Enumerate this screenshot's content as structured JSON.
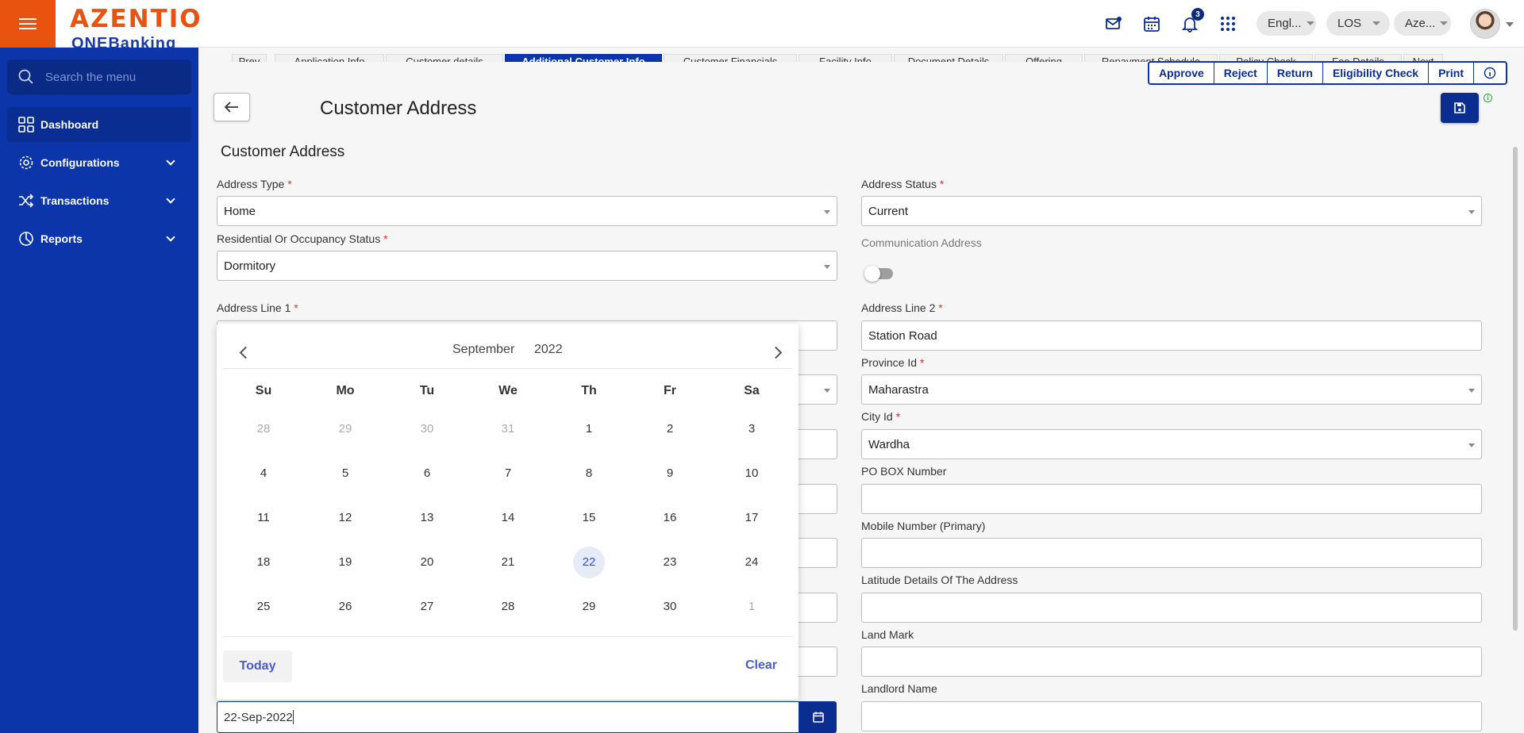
{
  "header": {
    "logo_main": "AZENTIO",
    "logo_sub": "ONEBanking",
    "notification_count": "3",
    "language": "Engl...",
    "module": "LOS",
    "entity": "Aze..."
  },
  "sidebar": {
    "search_placeholder": "Search the menu",
    "items": [
      {
        "label": "Dashboard",
        "icon": "dashboard-icon"
      },
      {
        "label": "Configurations",
        "icon": "gear-icon"
      },
      {
        "label": "Transactions",
        "icon": "shuffle-icon"
      },
      {
        "label": "Reports",
        "icon": "pie-chart-icon"
      }
    ]
  },
  "tabs": [
    "Prev",
    "Application Info",
    "Customer details",
    "Additional Customer Info",
    "Customer Financials",
    "Facility Info",
    "Document Details",
    "Offering",
    "Repayment Schedule",
    "Policy Check",
    "Fee Details",
    "Next"
  ],
  "active_tab": "Additional Customer Info",
  "actions": [
    "Approve",
    "Reject",
    "Return",
    "Eligibility Check",
    "Print"
  ],
  "page": {
    "title": "Customer Address",
    "section_title": "Customer Address"
  },
  "form": {
    "address_type": {
      "label": "Address Type",
      "value": "Home"
    },
    "address_status": {
      "label": "Address Status",
      "value": "Current"
    },
    "residential_status": {
      "label": "Residential Or Occupancy Status",
      "value": "Dormitory"
    },
    "communication_address": {
      "label": "Communication Address"
    },
    "address_line_1": {
      "label": "Address Line 1",
      "value": ""
    },
    "address_line_2": {
      "label": "Address Line 2",
      "value": "Station Road"
    },
    "province_id": {
      "label": "Province Id",
      "value": "Maharastra"
    },
    "city_id": {
      "label": "City Id",
      "value": "Wardha"
    },
    "po_box": {
      "label": "PO BOX Number",
      "value": ""
    },
    "mobile_primary": {
      "label": "Mobile Number (Primary)",
      "value": ""
    },
    "latitude": {
      "label": "Latitude Details Of The Address",
      "value": ""
    },
    "land_mark": {
      "label": "Land Mark",
      "value": ""
    },
    "landlord_name": {
      "label": "Landlord Name",
      "value": ""
    },
    "date_value": "22-Sep-2022"
  },
  "datepicker": {
    "month": "September",
    "year": "2022",
    "weekdays": [
      "Su",
      "Mo",
      "Tu",
      "We",
      "Th",
      "Fr",
      "Sa"
    ],
    "weeks": [
      [
        "28",
        "29",
        "30",
        "31",
        "1",
        "2",
        "3"
      ],
      [
        "4",
        "5",
        "6",
        "7",
        "8",
        "9",
        "10"
      ],
      [
        "11",
        "12",
        "13",
        "14",
        "15",
        "16",
        "17"
      ],
      [
        "18",
        "19",
        "20",
        "21",
        "22",
        "23",
        "24"
      ],
      [
        "25",
        "26",
        "27",
        "28",
        "29",
        "30",
        "1"
      ]
    ],
    "selected": "22",
    "today_label": "Today",
    "clear_label": "Clear"
  },
  "colors": {
    "brand_orange": "#e8540f",
    "sidebar_blue": "#0b35a8",
    "button_navy": "#0b2d8f"
  }
}
